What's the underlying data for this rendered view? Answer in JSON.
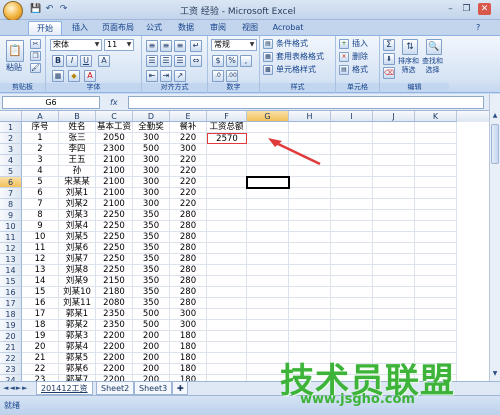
{
  "window": {
    "title": "工资 经验 - Microsoft Excel",
    "minimize": "–",
    "restore": "❐",
    "close": "✕"
  },
  "quick_access": {
    "save": "💾",
    "undo": "↶",
    "redo": "↷"
  },
  "tabs": [
    "开始",
    "插入",
    "页面布局",
    "公式",
    "数据",
    "审阅",
    "视图",
    "Acrobat"
  ],
  "ribbon": {
    "clipboard": {
      "label": "剪贴板",
      "paste": "粘贴"
    },
    "font": {
      "label": "字体",
      "name": "宋体",
      "size": "11",
      "bold": "B",
      "italic": "I",
      "underline": "U",
      "grow": "A",
      "fontcolor": "A"
    },
    "alignment": {
      "label": "对齐方式"
    },
    "number": {
      "label": "数字",
      "format": "常规",
      "currency": "$",
      "percent": "%",
      "comma": ","
    },
    "styles": {
      "label": "样式",
      "conditional": "条件格式",
      "table": "套用表格格式",
      "cell": "单元格样式"
    },
    "cells": {
      "label": "单元格",
      "insert": "插入",
      "delete": "删除",
      "format": "格式"
    },
    "editing": {
      "label": "编辑",
      "sum": "Σ",
      "sort": "排序和\n筛选",
      "find": "查找和\n选择"
    }
  },
  "formula_bar": {
    "namebox": "G6",
    "fx": "fx",
    "content": ""
  },
  "columns": [
    "A",
    "B",
    "C",
    "D",
    "E",
    "F",
    "G",
    "H",
    "I",
    "J",
    "K"
  ],
  "selected_column": "G",
  "selected_row": 6,
  "rows": [
    [
      "序号",
      "姓名",
      "基本工资",
      "全勤奖",
      "餐补",
      "工资总额"
    ],
    [
      "1",
      "张三",
      "2050",
      "300",
      "220",
      "2570"
    ],
    [
      "2",
      "李四",
      "2300",
      "500",
      "300",
      ""
    ],
    [
      "3",
      "王五",
      "2100",
      "300",
      "220",
      ""
    ],
    [
      "4",
      "孙",
      "2100",
      "300",
      "220",
      ""
    ],
    [
      "5",
      "宋某某",
      "2100",
      "300",
      "220",
      ""
    ],
    [
      "6",
      "刘某1",
      "2100",
      "300",
      "220",
      ""
    ],
    [
      "7",
      "刘某2",
      "2100",
      "300",
      "220",
      ""
    ],
    [
      "8",
      "刘某3",
      "2250",
      "350",
      "280",
      ""
    ],
    [
      "9",
      "刘某4",
      "2250",
      "350",
      "280",
      ""
    ],
    [
      "10",
      "刘某5",
      "2250",
      "350",
      "280",
      ""
    ],
    [
      "11",
      "刘某6",
      "2250",
      "350",
      "280",
      ""
    ],
    [
      "12",
      "刘某7",
      "2250",
      "350",
      "280",
      ""
    ],
    [
      "13",
      "刘某8",
      "2250",
      "350",
      "280",
      ""
    ],
    [
      "14",
      "刘某9",
      "2150",
      "350",
      "280",
      ""
    ],
    [
      "15",
      "刘某10",
      "2180",
      "350",
      "280",
      ""
    ],
    [
      "16",
      "刘某11",
      "2080",
      "350",
      "280",
      ""
    ],
    [
      "17",
      "郭某1",
      "2350",
      "500",
      "300",
      ""
    ],
    [
      "18",
      "郭某2",
      "2350",
      "500",
      "300",
      ""
    ],
    [
      "19",
      "郭某3",
      "2200",
      "200",
      "180",
      ""
    ],
    [
      "20",
      "郭某4",
      "2200",
      "200",
      "180",
      ""
    ],
    [
      "21",
      "郭某5",
      "2200",
      "200",
      "180",
      ""
    ],
    [
      "22",
      "郭某6",
      "2200",
      "200",
      "180",
      ""
    ],
    [
      "23",
      "郭某7",
      "2200",
      "200",
      "180",
      ""
    ]
  ],
  "sheets": [
    "201412工资",
    "Sheet2",
    "Sheet3"
  ],
  "status": "就绪",
  "watermark": {
    "text": "技术员联盟",
    "url": "www.jsgho.com"
  },
  "colors": {
    "accent": "#15428b",
    "arrow": "#e03a3a",
    "highlight": "#e03a3a",
    "watermark": "#3db33a"
  }
}
